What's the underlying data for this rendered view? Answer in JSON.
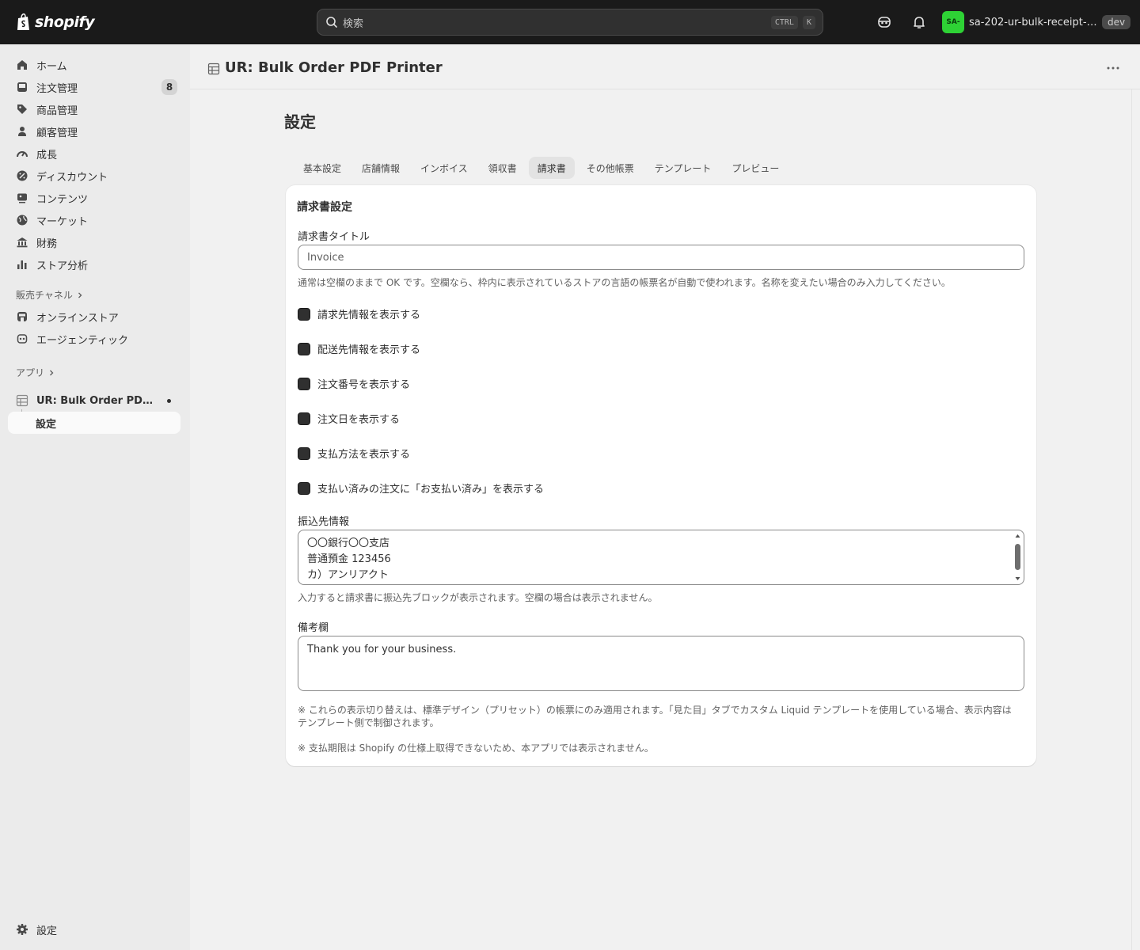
{
  "topbar": {
    "logo_text": "shopify",
    "search_placeholder": "検索",
    "kbd_ctrl": "CTRL",
    "kbd_k": "K",
    "avatar_initials": "SA-",
    "store_name": "sa-202-ur-bulk-receipt-app",
    "dev_badge": "dev"
  },
  "sidebar": {
    "items": [
      {
        "label": "ホーム",
        "icon": "home-icon"
      },
      {
        "label": "注文管理",
        "icon": "inbox-icon",
        "badge": "8"
      },
      {
        "label": "商品管理",
        "icon": "tag-icon"
      },
      {
        "label": "顧客管理",
        "icon": "person-icon"
      },
      {
        "label": "成長",
        "icon": "gauge-icon"
      },
      {
        "label": "ディスカウント",
        "icon": "discount-icon"
      },
      {
        "label": "コンテンツ",
        "icon": "content-icon"
      },
      {
        "label": "マーケット",
        "icon": "globe-icon"
      },
      {
        "label": "財務",
        "icon": "bank-icon"
      },
      {
        "label": "ストア分析",
        "icon": "bar-chart-icon"
      }
    ],
    "sales_channels_label": "販売チャネル",
    "channels": [
      {
        "label": "オンラインストア",
        "icon": "store-icon"
      },
      {
        "label": "エージェンティック",
        "icon": "robot-icon"
      }
    ],
    "apps_label": "アプリ",
    "app_name": "UR: Bulk Order PDF Printer",
    "app_sub": "設定",
    "settings_label": "設定"
  },
  "header": {
    "app_title": "UR: Bulk Order PDF Printer"
  },
  "page": {
    "title": "設定",
    "tabs": [
      "基本設定",
      "店舗情報",
      "インボイス",
      "領収書",
      "請求書",
      "その他帳票",
      "テンプレート",
      "プレビュー"
    ],
    "active_tab": "請求書"
  },
  "card": {
    "title": "請求書設定",
    "invoice_title_label": "請求書タイトル",
    "invoice_title_placeholder": "Invoice",
    "invoice_title_help": "通常は空欄のままで OK です。空欄なら、枠内に表示されているストアの言語の帳票名が自動で使われます。名称を変えたい場合のみ入力してください。",
    "checkboxes": [
      "請求先情報を表示する",
      "配送先情報を表示する",
      "注文番号を表示する",
      "注文日を表示する",
      "支払方法を表示する",
      "支払い済みの注文に「お支払い済み」を表示する"
    ],
    "bank_label": "振込先情報",
    "bank_lines": [
      "〇〇銀行〇〇支店",
      "普通預金 123456",
      "カ）アンリアクト"
    ],
    "bank_help": "入力すると請求書に振込先ブロックが表示されます。空欄の場合は表示されません。",
    "remarks_label": "備考欄",
    "remarks_value": "Thank you for your business.",
    "note1": "※ これらの表示切り替えは、標準デザイン（プリセット）の帳票にのみ適用されます。「見た目」タブでカスタム Liquid テンプレートを使用している場合、表示内容はテンプレート側で制御されます。",
    "note2": "※ 支払期限は Shopify の仕様上取得できないため、本アプリでは表示されません。"
  }
}
